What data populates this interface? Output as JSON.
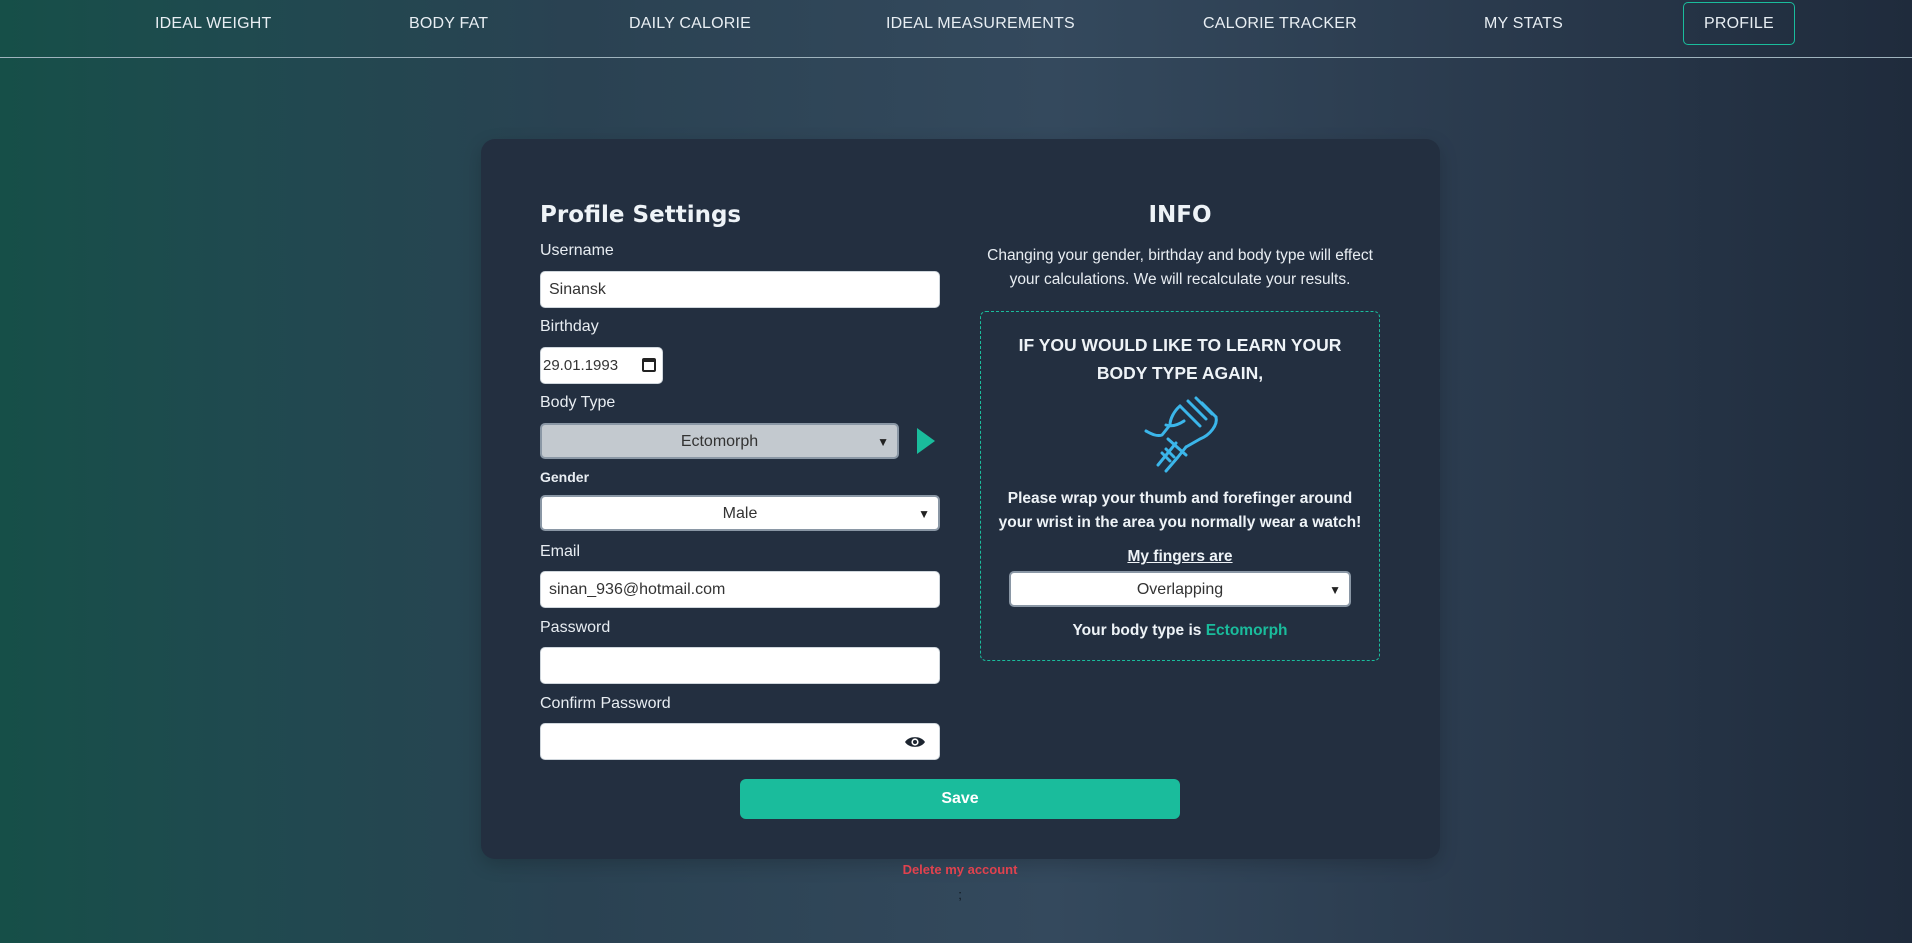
{
  "nav": {
    "items": [
      {
        "label": "IDEAL WEIGHT"
      },
      {
        "label": "BODY FAT"
      },
      {
        "label": "DAILY CALORIE"
      },
      {
        "label": "IDEAL MEASUREMENTS"
      },
      {
        "label": "CALORIE TRACKER"
      },
      {
        "label": "MY STATS"
      },
      {
        "label": "PROFILE",
        "active": true
      }
    ]
  },
  "profile": {
    "title": "Profile Settings",
    "username_label": "Username",
    "username_value": "Sinansk",
    "birthday_label": "Birthday",
    "birthday_value": "29.01.1993",
    "body_type_label": "Body Type",
    "body_type_value": "Ectomorph",
    "gender_label": "Gender",
    "gender_value": "Male",
    "email_label": "Email",
    "email_value": "sinan_936@hotmail.com",
    "password_label": "Password",
    "password_value": "",
    "confirm_password_label": "Confirm Password",
    "confirm_password_value": "",
    "save_label": "Save",
    "delete_label": "Delete my account",
    "footer_mark": ";"
  },
  "info": {
    "title": "INFO",
    "description": "Changing your gender, birthday and body type will effect your calculations. We will recalculate your results.",
    "learn_heading": "IF YOU WOULD LIKE TO LEARN YOUR BODY TYPE AGAIN,",
    "wrist_icon": "wrist-grab-icon",
    "instruction": "Please wrap your thumb and forefinger around your wrist in the area you normally wear a watch!",
    "fingers_label": "My fingers are",
    "fingers_value": "Overlapping",
    "result_prefix": "Your body type is",
    "result_value": "Ectomorph"
  },
  "colors": {
    "accent": "#1abc9c",
    "card": "#232f40",
    "danger": "#e0424e"
  }
}
